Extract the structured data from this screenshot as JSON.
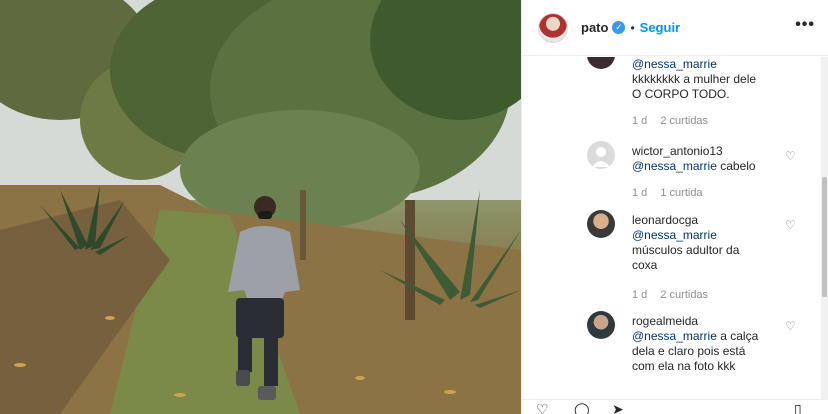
{
  "post": {
    "username": "pato",
    "verified_icon": "verified-badge-icon",
    "separator": "•",
    "follow_label": "Seguir",
    "more_label": "•••"
  },
  "comments": [
    {
      "mention": "@nessa_marrie",
      "text_lines": [
        "kkkkkkkk a mulher dele",
        "O CORPO TODO."
      ],
      "time": "1 d",
      "likes": "2 curtidas"
    },
    {
      "username": "wictor_antonio13",
      "mention": "@nessa_marrie",
      "text_lines": [
        "cabelo"
      ],
      "time": "1 d",
      "likes": "1 curtida"
    },
    {
      "username": "leonardocga",
      "mention": "@nessa_marrie",
      "text_lines": [
        "músculos adultor da",
        "coxa"
      ],
      "time": "1 d",
      "likes": "2 curtidas"
    },
    {
      "username": "rogealmeida",
      "mention": "@nessa_marrie",
      "text_lines": [
        "a calça",
        "dela e claro pois está",
        "com ela na foto kkk"
      ]
    }
  ],
  "icons": {
    "heart": "heart-icon",
    "comment": "comment-icon",
    "share": "share-icon",
    "bookmark": "bookmark-icon"
  },
  "colors": {
    "link": "#0095f6",
    "mention": "#00376b",
    "meta": "#8e8e8e"
  }
}
